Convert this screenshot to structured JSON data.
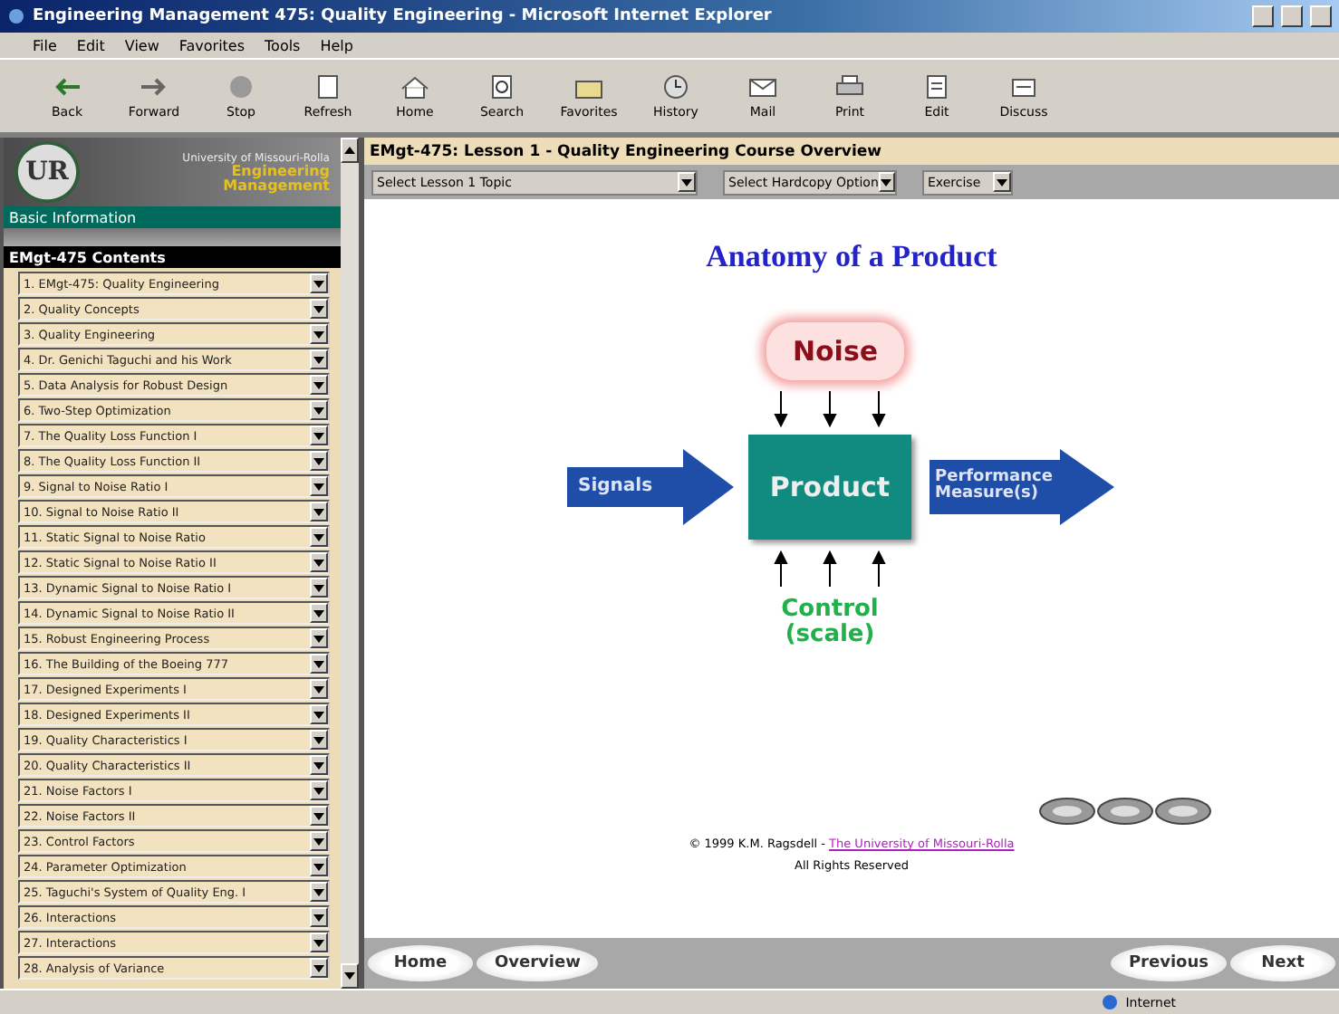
{
  "window": {
    "title": "Engineering Management 475: Quality Engineering - Microsoft Internet Explorer"
  },
  "menu": [
    "File",
    "Edit",
    "View",
    "Favorites",
    "Tools",
    "Help"
  ],
  "toolbar": [
    {
      "kind": "back",
      "label": "Back"
    },
    {
      "kind": "forward",
      "label": "Forward"
    },
    {
      "kind": "stop",
      "label": "Stop"
    },
    {
      "kind": "refresh",
      "label": "Refresh"
    },
    {
      "kind": "home",
      "label": "Home"
    },
    {
      "kind": "search",
      "label": "Search"
    },
    {
      "kind": "favorites",
      "label": "Favorites"
    },
    {
      "kind": "history",
      "label": "History"
    },
    {
      "kind": "mail",
      "label": "Mail"
    },
    {
      "kind": "print",
      "label": "Print"
    },
    {
      "kind": "edit",
      "label": "Edit"
    },
    {
      "kind": "discuss",
      "label": "Discuss"
    }
  ],
  "sidebar": {
    "university": "University of Missouri-Rolla",
    "department": "Engineering Management",
    "logo": "UR",
    "section": "Basic Information",
    "contents_title": "EMgt-475 Contents",
    "items": [
      "1. EMgt-475: Quality Engineering",
      "2. Quality Concepts",
      "3. Quality Engineering",
      "4. Dr. Genichi Taguchi and his Work",
      "5. Data Analysis for Robust Design",
      "6. Two-Step Optimization",
      "7. The Quality Loss Function I",
      "8. The Quality Loss Function II",
      "9. Signal to Noise Ratio I",
      "10. Signal to Noise Ratio II",
      "11. Static Signal to Noise Ratio",
      "12. Static Signal to Noise Ratio II",
      "13. Dynamic Signal to Noise Ratio I",
      "14. Dynamic Signal to Noise Ratio II",
      "15. Robust Engineering Process",
      "16. The Building of the Boeing 777",
      "17. Designed Experiments I",
      "18. Designed Experiments II",
      "19. Quality Characteristics I",
      "20. Quality Characteristics II",
      "21. Noise Factors I",
      "22. Noise Factors II",
      "23. Control Factors",
      "24. Parameter Optimization",
      "25. Taguchi's System of Quality Eng. I",
      "26. Interactions",
      "27. Interactions",
      "28. Analysis of Variance"
    ]
  },
  "lesson": {
    "header": "EMgt-475: Lesson 1 - Quality Engineering Course Overview",
    "selects": [
      "Select Lesson 1 Topic",
      "Select Hardcopy Option",
      "Exercise"
    ],
    "title": "Anatomy of a Product",
    "diagram": {
      "noise": "Noise",
      "input": "Signals",
      "product": "Product",
      "output": "Performance Measure(s)",
      "control_line1": "Control",
      "control_line2": "(scale)"
    },
    "copyright": "© 1999 K.M. Ragsdell - ",
    "copyright_link": "The University of Missouri-Rolla",
    "rights": "All Rights Reserved"
  },
  "nav": {
    "left": [
      "Home",
      "Overview"
    ],
    "right": [
      "Previous",
      "Next"
    ]
  },
  "status_bar": {
    "zone": "Internet"
  }
}
